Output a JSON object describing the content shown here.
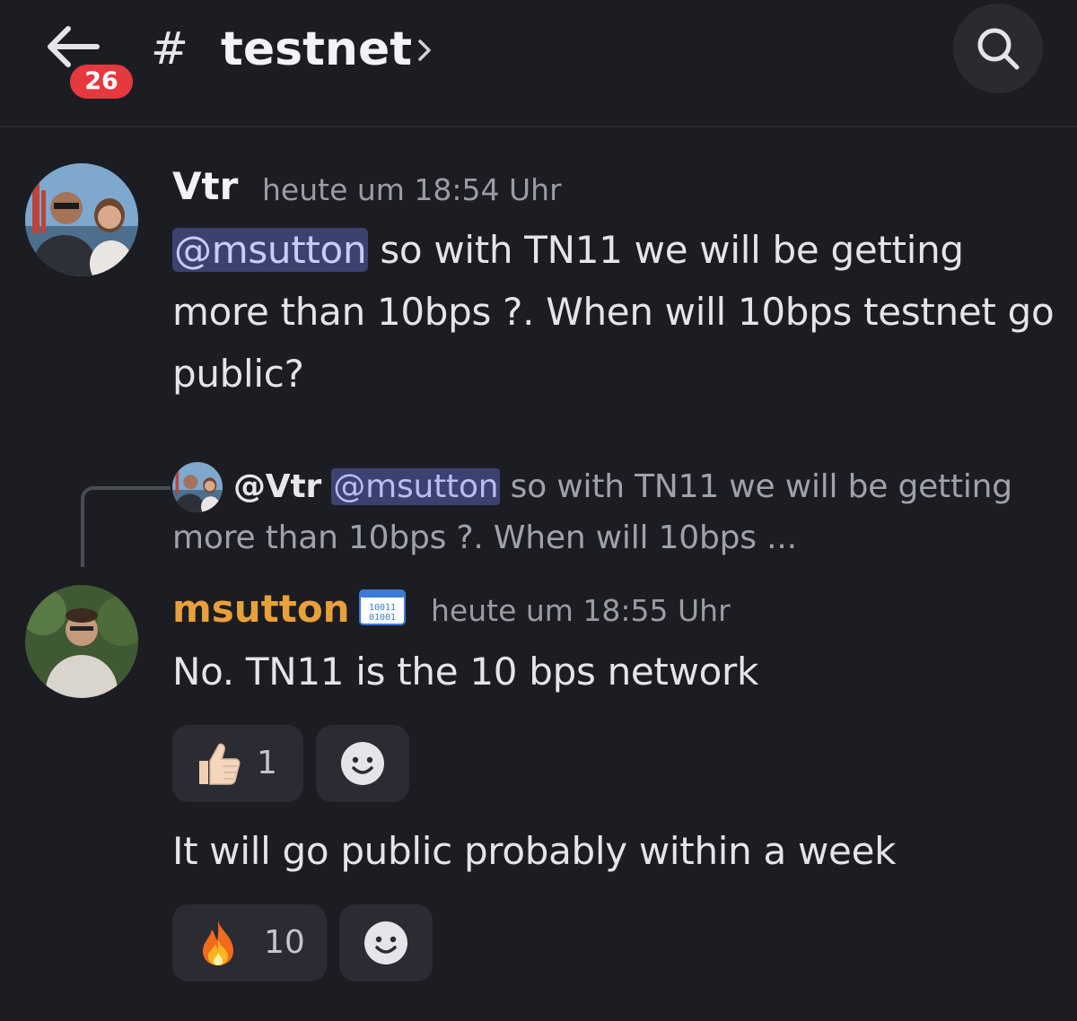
{
  "header": {
    "unread_count": "26",
    "channel_prefix": "#",
    "channel_name": "testnet"
  },
  "messages": [
    {
      "author": "Vtr",
      "author_color": "#f2f3f5",
      "timestamp": "heute um 18:54 Uhr",
      "mention": "@msutton",
      "text": " so with TN11 we will be getting more than 10bps ?. When will 10bps testnet go public?"
    },
    {
      "reply": {
        "author": "@Vtr",
        "mention": "@msutton",
        "text": " so with TN11 we will be getting more than 10bps ?. When will 10bps ..."
      },
      "author": "msutton",
      "author_color": "#e8a03a",
      "badge_icon": "binary-code-icon",
      "timestamp": "heute um 18:55 Uhr",
      "text": "No. TN11 is the 10 bps network",
      "reaction": {
        "emoji": "thumbs-up-icon",
        "count": "1"
      }
    },
    {
      "text": "It will go public probably within a week",
      "reaction": {
        "emoji": "fire-icon",
        "count": "10"
      }
    }
  ],
  "colors": {
    "background": "#1c1d23",
    "mention_bg": "#3c4270",
    "badge_red": "#e5383f",
    "msutton_orange": "#e8a03a"
  }
}
